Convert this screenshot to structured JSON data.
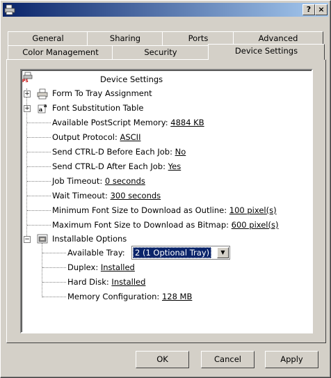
{
  "titlebar": {
    "help_label": "?",
    "close_label": "×"
  },
  "tabs": {
    "row1": [
      "General",
      "Sharing",
      "Ports",
      "Advanced"
    ],
    "row2": [
      "Color Management",
      "Security",
      "Device Settings"
    ]
  },
  "tree": {
    "root_label": "Device Settings",
    "form_to_tray": "Form To Tray Assignment",
    "font_substitution": "Font Substitution Table",
    "ps_memory": {
      "label": "Available PostScript Memory: ",
      "value": "4884 KB"
    },
    "output_protocol": {
      "label": "Output Protocol: ",
      "value": "ASCII"
    },
    "ctrl_d_before": {
      "label": "Send CTRL-D Before Each Job: ",
      "value": "No"
    },
    "ctrl_d_after": {
      "label": "Send CTRL-D After Each Job: ",
      "value": "Yes"
    },
    "job_timeout": {
      "label": "Job Timeout: ",
      "value": "0 seconds"
    },
    "wait_timeout": {
      "label": "Wait Timeout: ",
      "value": "300 seconds"
    },
    "min_font": {
      "label": "Minimum Font Size to Download as Outline: ",
      "value": "100 pixel(s)"
    },
    "max_font": {
      "label": "Maximum Font Size to Download as Bitmap: ",
      "value": "600 pixel(s)"
    },
    "installable_options": "Installable Options",
    "available_tray": {
      "label": "Available Tray:",
      "value": "2 (1 Optional Tray)"
    },
    "duplex": {
      "label": "Duplex: ",
      "value": "Installed"
    },
    "hard_disk": {
      "label": "Hard Disk: ",
      "value": "Installed"
    },
    "memory_config": {
      "label": "Memory Configuration: ",
      "value": "128 MB"
    }
  },
  "buttons": {
    "ok": "OK",
    "cancel": "Cancel",
    "apply": "Apply"
  }
}
